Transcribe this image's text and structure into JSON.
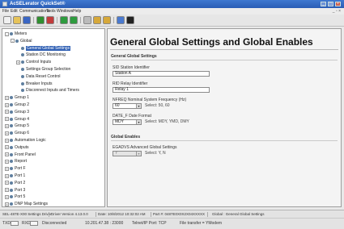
{
  "window": {
    "title": "AcSELerator QuickSet®"
  },
  "menu": [
    "File",
    "Edit",
    "Communications",
    "Tools",
    "Windows",
    "Help"
  ],
  "toolbar": [
    {
      "name": "new-icon",
      "color": "#f0f0f0"
    },
    {
      "name": "open-icon",
      "color": "#e6c35a"
    },
    {
      "name": "save-icon",
      "color": "#3a66c4"
    },
    {
      "name": "read-icon",
      "color": "#2f8f2f"
    },
    {
      "name": "send-icon",
      "color": "#c23b3b"
    },
    {
      "name": "connect-icon",
      "color": "#2e9b3e"
    },
    {
      "name": "disconnect-icon",
      "color": "#2e9b3e"
    },
    {
      "name": "settings-icon",
      "color": "#bbbbbb"
    },
    {
      "name": "back-icon",
      "color": "#d6a83a"
    },
    {
      "name": "forward-icon",
      "color": "#d6a83a"
    },
    {
      "name": "hmi-icon",
      "color": "#4a7ad0"
    },
    {
      "name": "terminal-icon",
      "color": "#222222"
    }
  ],
  "tree": [
    {
      "label": "Meters",
      "exp": "-",
      "indent": 0
    },
    {
      "label": "Global",
      "exp": "-",
      "indent": 1
    },
    {
      "label": "General Global Settings",
      "exp": "",
      "indent": 2,
      "selected": true
    },
    {
      "label": "Station DC Monitoring",
      "exp": "",
      "indent": 2
    },
    {
      "label": "Control Inputs",
      "exp": "+",
      "indent": 2
    },
    {
      "label": "Settings Group Selection",
      "exp": "",
      "indent": 2
    },
    {
      "label": "Data Reset Control",
      "exp": "",
      "indent": 2
    },
    {
      "label": "Breaker Inputs",
      "exp": "",
      "indent": 2
    },
    {
      "label": "Disconnect Inputs and Timers",
      "exp": "",
      "indent": 2
    },
    {
      "label": "Group 1",
      "exp": "+",
      "indent": 0
    },
    {
      "label": "Group 2",
      "exp": "+",
      "indent": 0
    },
    {
      "label": "Group 3",
      "exp": "+",
      "indent": 0
    },
    {
      "label": "Group 4",
      "exp": "+",
      "indent": 0
    },
    {
      "label": "Group 5",
      "exp": "+",
      "indent": 0
    },
    {
      "label": "Group 6",
      "exp": "+",
      "indent": 0
    },
    {
      "label": "Automation Logic",
      "exp": "+",
      "indent": 0
    },
    {
      "label": "Outputs",
      "exp": "+",
      "indent": 0
    },
    {
      "label": "Front Panel",
      "exp": "+",
      "indent": 0
    },
    {
      "label": "Report",
      "exp": "+",
      "indent": 0
    },
    {
      "label": "Port F",
      "exp": "+",
      "indent": 0
    },
    {
      "label": "Port 1",
      "exp": "+",
      "indent": 0
    },
    {
      "label": "Port 2",
      "exp": "+",
      "indent": 0
    },
    {
      "label": "Port 3",
      "exp": "+",
      "indent": 0
    },
    {
      "label": "Port 5",
      "exp": "+",
      "indent": 0
    },
    {
      "label": "DNP Map Settings",
      "exp": "+",
      "indent": 0
    }
  ],
  "main": {
    "title": "General Global Settings and Global Enables",
    "section1": "General Global Settings",
    "sid_label": "SID Station Identifier",
    "sid_value": "Station A",
    "rid_label": "RID Relay Identifier",
    "rid_value": "Relay 1",
    "nfreq_label": "NFREQ Nominal System Frequency (Hz)",
    "nfreq_value": "60",
    "nfreq_hint": "Select: 50, 60",
    "datef_label": "DATE_F Date Format",
    "datef_value": "MDY",
    "datef_hint": "Select: MDY, YMD, DMY",
    "section2": "Global Enables",
    "eagvis_label": "EGADVS Advanced Global Settings",
    "eagvis_value": "Y",
    "eagvis_hint": "Select: Y, N"
  },
  "status1": [
    "SEL-487E-X00 Settings Driver",
    "Driver Version 4.13.0.0",
    "Date: 10/8/2012 10:32:02 AM",
    "Part #: 0487E0X0X2X04XXXXX",
    "Global : General Global Settings"
  ],
  "status2": {
    "tx_label": "TXD",
    "rx_label": "RXD",
    "state": "Disconnected",
    "addr": "10.201.47.38 : 23000",
    "protocol": "Telnet/IP Port: TCP",
    "transfer": "File transfer = YModem"
  }
}
